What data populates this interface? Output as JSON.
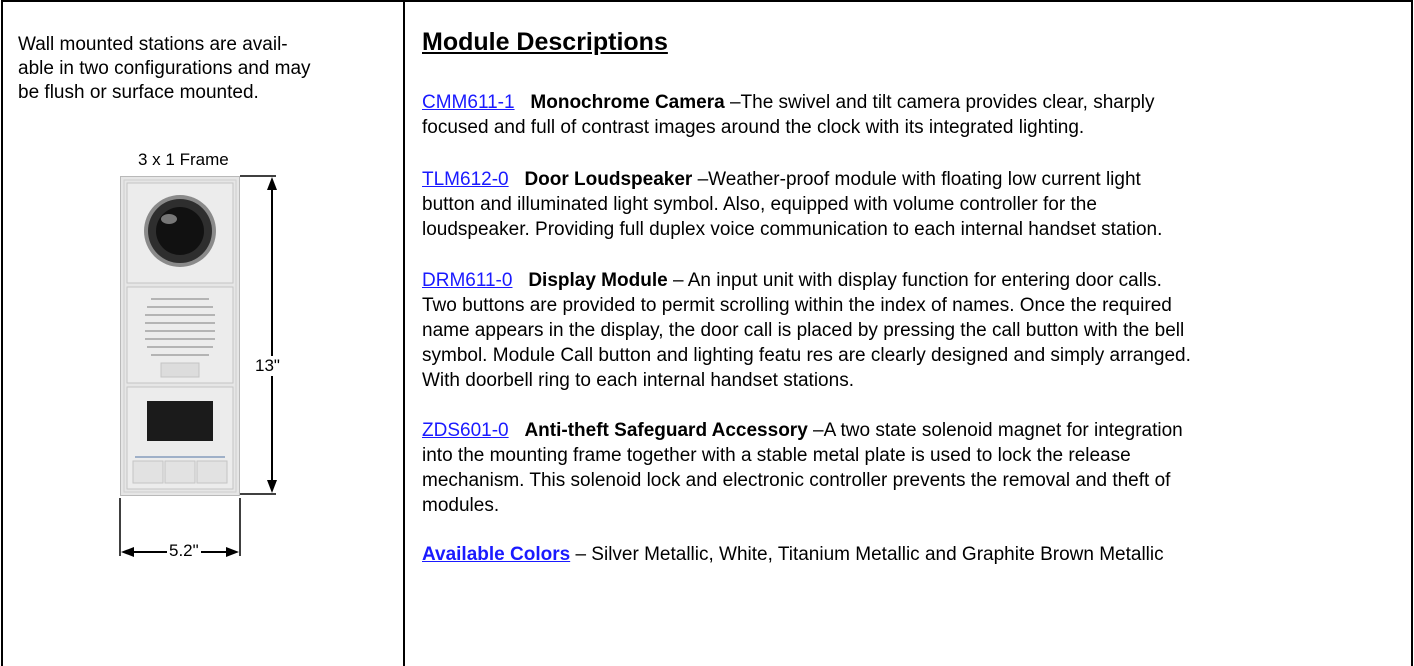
{
  "left": {
    "intro_lines": [
      "Wall mounted stations are  avail-",
      "able in two configurations and may",
      "be flush or surface mounted."
    ],
    "frame_label": "3 x 1 Frame",
    "height_label": "13\"",
    "width_label": "5.2\""
  },
  "right": {
    "heading": "Module Descriptions",
    "modules": [
      {
        "code": "CMM611-1",
        "name": "Monochrome Camera",
        "first_line": " –The swivel and tilt camera provides clear, sharply",
        "lines": [
          "focused and full of contrast images around the clock with its integrated lighting."
        ]
      },
      {
        "code": "TLM612-0",
        "name": "Door Loudspeaker",
        "first_line": " –Weather-proof module with floating low current light",
        "lines": [
          "button and illuminated light symbol.  Also, equipped with volume controller for the",
          "loudspeaker.  Providing full duplex voice communication to each internal handset station."
        ]
      },
      {
        "code": "DRM611-0",
        "name": "Display Module",
        "first_line": " – An input unit with display function for entering door calls.",
        "lines": [
          "Two buttons are provided to permit scrolling within the index of names. Once the required",
          "name appears in the display, the door call is placed by pressing the call button with the bell",
          "symbol.  Module Call button and lighting featu res are clearly designed and simply arranged.",
          "With doorbell ring to each internal handset stations."
        ]
      },
      {
        "code": "ZDS601-0",
        "name": "Anti-theft Safeguard Accessory",
        "first_line": " –A two state solenoid magnet for integration",
        "lines": [
          "into the mounting frame together with a stable metal plate is used to lock the release",
          "mechanism. This solenoid lock and electronic controller prevents the removal and theft of",
          "modules."
        ]
      }
    ],
    "colors_link": "Available Colors",
    "colors_text": " – Silver Metallic, White, Titanium Metallic and Graphite Brown Metallic"
  }
}
